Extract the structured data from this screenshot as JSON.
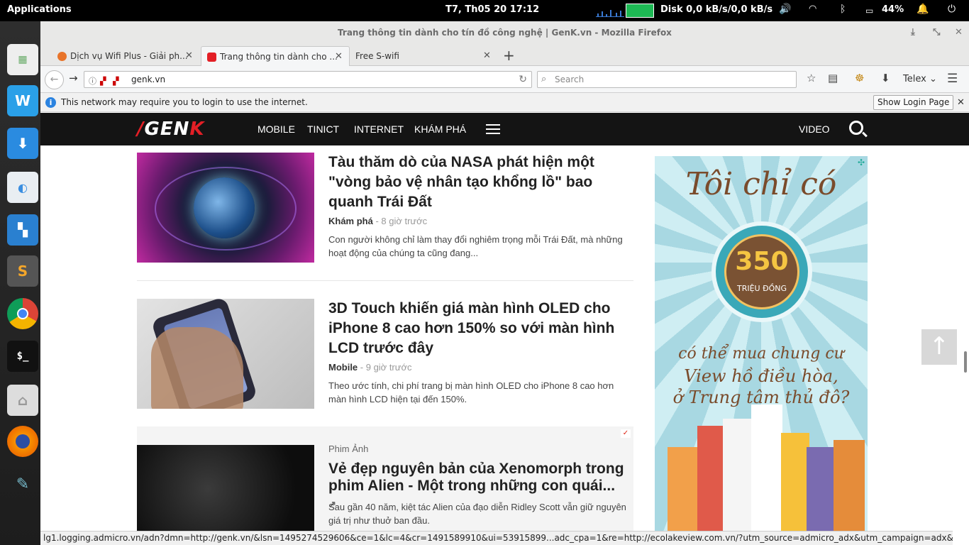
{
  "system": {
    "apps_label": "Applications",
    "clock": "T7, Th05 20     17:12",
    "disk": "Disk 0,0 kB/s/0,0 kB/s",
    "battery": "44%"
  },
  "window": {
    "title": "Trang thông tin dành cho tín đồ công nghệ | GenK.vn - Mozilla Firefox"
  },
  "tabs": [
    {
      "label": "Dịch vụ Wifi Plus - Giải ph...",
      "favicon_color": "#e8742a"
    },
    {
      "label": "Trang thông tin dành cho ...",
      "favicon_color": "#e31f26"
    },
    {
      "label": "Free S-wifi",
      "favicon_color": ""
    }
  ],
  "navbar": {
    "url": "genk.vn",
    "search_placeholder": "Search",
    "input_method": "Telex"
  },
  "notification": {
    "message": "This network may require you to login to use the internet.",
    "button": "Show Login Page"
  },
  "site": {
    "logo_slash": "/",
    "logo_text": "GEN",
    "logo_k": "K",
    "menu": [
      "MOBILE",
      "TINICT",
      "INTERNET",
      "KHÁM PHÁ"
    ],
    "video": "VIDEO"
  },
  "articles": [
    {
      "title": "Tàu thăm dò của NASA phát hiện một \"vòng bảo vệ nhân tạo khổng lồ\" bao quanh Trái Đất",
      "category": "Khám phá",
      "time": " - 8 giờ trước",
      "desc": "Con người không chỉ làm thay đổi nghiêm trọng mỗi Trái Đất, mà những hoạt động của chúng ta cũng đang..."
    },
    {
      "title": "3D Touch khiến giá màn hình OLED cho iPhone 8 cao hơn 150% so với màn hình LCD trước đây",
      "category": "Mobile",
      "time": " - 9 giờ trước",
      "desc": "Theo ước tính, chi phí trang bị màn hình OLED cho iPhone 8 cao hơn màn hình LCD hiện tại đến 150%."
    },
    {
      "label": "Phim Ảnh",
      "title": "Vẻ đẹp nguyên bản của Xenomorph trong phim Alien - Một trong những con quái...",
      "desc": "Sau gần 40 năm, kiệt tác Alien của đạo diễn Ridley Scott vẫn giữ nguyên giá trị như thuở ban đầu."
    }
  ],
  "ad": {
    "headline": "Tôi chỉ có",
    "amount": "350",
    "amount_unit": "TRIỆU ĐỒNG",
    "line1": "có thể mua chung cư",
    "line2": "View hồ điều hòa,",
    "line3": "ở Trung tâm thủ đô?"
  },
  "statusbar": "lg1.logging.admicro.vn/adn?dmn=http://genk.vn/&lsn=1495274529606&ce=1&lc=4&cr=1491589910&ui=53915899...adc_cpa=1&re=http://ecolakeview.com.vn/?utm_source=admicro_adx&utm_campaign=adx&utm_content=genk.vn"
}
